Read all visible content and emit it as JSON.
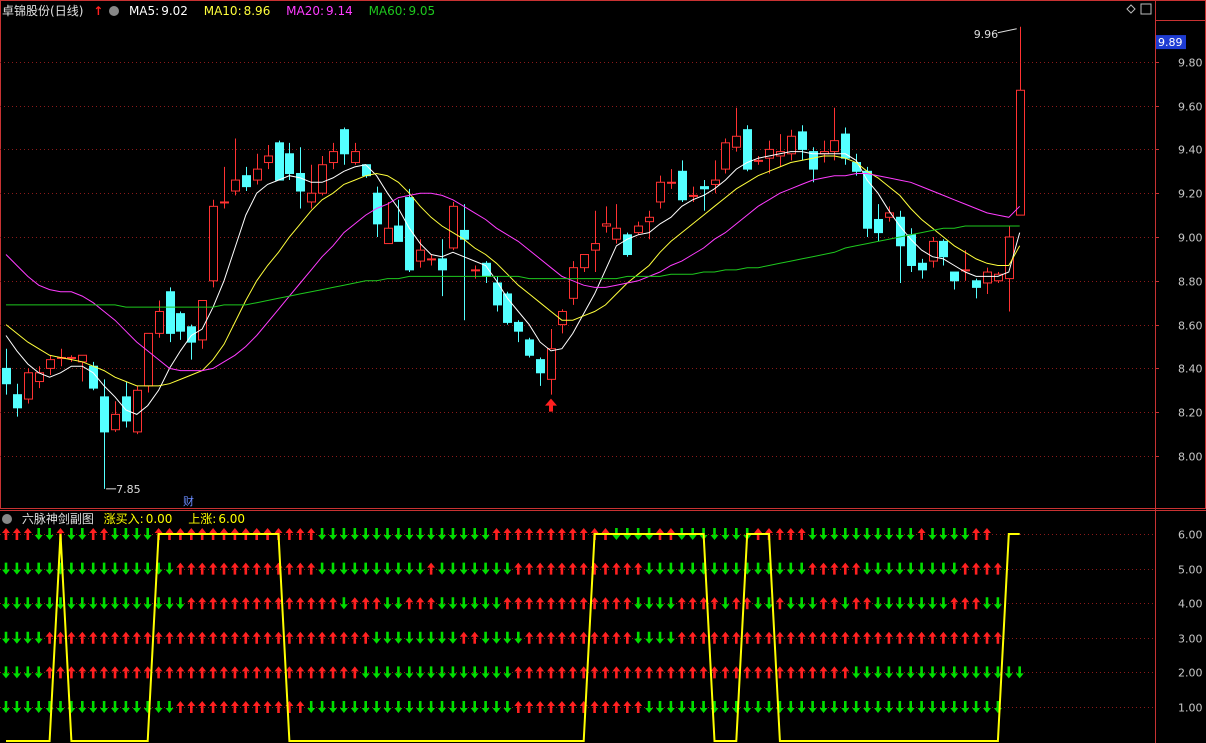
{
  "main_header": {
    "stock_name": "卓锦股份",
    "period": "(日线)",
    "ma5_label": "MA5:",
    "ma5_value": "9.02",
    "ma10_label": "MA10:",
    "ma10_value": "8.96",
    "ma20_label": "MA20:",
    "ma20_value": "9.14",
    "ma60_label": "MA60:",
    "ma60_value": "9.05"
  },
  "sub_header": {
    "indicator_name": "六脉神剑副图",
    "buy_label": "涨买入:",
    "buy_value": "0.00",
    "up_label": "上涨:",
    "up_value": "6.00"
  },
  "annotations": {
    "high_label": "9.96",
    "low_label": "7.85",
    "current_price": "9.89",
    "finance_marker": "财"
  },
  "colors": {
    "up": "#ff3232",
    "down": "#54ffff",
    "ma5": "#ffffff",
    "ma10": "#ffff3c",
    "ma20": "#ff3cff",
    "ma60": "#1ec81e",
    "grid": "#8a1a1a",
    "axis_text": "#c8c8c8",
    "signal_line": "#ffff00",
    "arrow_up": "#ff2020",
    "arrow_down": "#00dd00"
  },
  "chart_data": [
    {
      "type": "candlestick",
      "title": "卓锦股份 (日线)",
      "y_ticks": [
        "9.80",
        "9.60",
        "9.40",
        "9.20",
        "9.00",
        "8.80",
        "8.60",
        "8.40",
        "8.20",
        "8.00"
      ],
      "ylim": [
        7.8,
        10.05
      ],
      "grid": true,
      "candles": [
        [
          8.4,
          8.33,
          8.49,
          8.28
        ],
        [
          8.28,
          8.22,
          8.33,
          8.18
        ],
        [
          8.26,
          8.38,
          8.4,
          8.24
        ],
        [
          8.34,
          8.38,
          8.41,
          8.31
        ],
        [
          8.4,
          8.44,
          8.46,
          8.37
        ],
        [
          8.45,
          8.45,
          8.49,
          8.41
        ],
        [
          8.45,
          8.45,
          8.46,
          8.43
        ],
        [
          8.43,
          8.46,
          8.46,
          8.34
        ],
        [
          8.41,
          8.31,
          8.43,
          8.3
        ],
        [
          8.27,
          8.11,
          8.35,
          7.85
        ],
        [
          8.12,
          8.19,
          8.25,
          8.11
        ],
        [
          8.27,
          8.16,
          8.34,
          8.13
        ],
        [
          8.11,
          8.3,
          8.32,
          8.1
        ],
        [
          8.32,
          8.56,
          8.56,
          8.29
        ],
        [
          8.56,
          8.66,
          8.71,
          8.54
        ],
        [
          8.75,
          8.56,
          8.77,
          8.52
        ],
        [
          8.65,
          8.57,
          8.66,
          8.53
        ],
        [
          8.59,
          8.52,
          8.6,
          8.44
        ],
        [
          8.53,
          8.71,
          8.71,
          8.49
        ],
        [
          8.8,
          9.14,
          9.17,
          8.77
        ],
        [
          9.16,
          9.16,
          9.32,
          9.13
        ],
        [
          9.21,
          9.26,
          9.45,
          9.19
        ],
        [
          9.28,
          9.23,
          9.32,
          9.21
        ],
        [
          9.26,
          9.31,
          9.38,
          9.24
        ],
        [
          9.34,
          9.37,
          9.42,
          9.31
        ],
        [
          9.43,
          9.26,
          9.44,
          9.26
        ],
        [
          9.38,
          9.29,
          9.43,
          9.26
        ],
        [
          9.29,
          9.21,
          9.41,
          9.13
        ],
        [
          9.16,
          9.2,
          9.33,
          9.13
        ],
        [
          9.2,
          9.33,
          9.37,
          9.19
        ],
        [
          9.34,
          9.39,
          9.43,
          9.31
        ],
        [
          9.49,
          9.38,
          9.5,
          9.33
        ],
        [
          9.34,
          9.39,
          9.43,
          9.33
        ],
        [
          9.33,
          9.28,
          9.33,
          9.27
        ],
        [
          9.2,
          9.06,
          9.23,
          9.0
        ],
        [
          8.97,
          9.04,
          9.16,
          8.97
        ],
        [
          9.05,
          8.98,
          9.17,
          8.98
        ],
        [
          9.18,
          8.85,
          9.22,
          8.84
        ],
        [
          8.89,
          8.94,
          8.99,
          8.86
        ],
        [
          8.9,
          8.9,
          8.92,
          8.87
        ],
        [
          8.9,
          8.85,
          8.99,
          8.73
        ],
        [
          8.95,
          9.14,
          9.16,
          8.94
        ],
        [
          9.03,
          8.99,
          9.15,
          8.62
        ],
        [
          8.85,
          8.85,
          8.87,
          8.81
        ],
        [
          8.88,
          8.82,
          8.89,
          8.79
        ],
        [
          8.79,
          8.69,
          8.82,
          8.66
        ],
        [
          8.74,
          8.61,
          8.75,
          8.6
        ],
        [
          8.61,
          8.57,
          8.62,
          8.52
        ],
        [
          8.53,
          8.46,
          8.54,
          8.45
        ],
        [
          8.44,
          8.38,
          8.45,
          8.32
        ],
        [
          8.35,
          8.49,
          8.58,
          8.28
        ],
        [
          8.6,
          8.66,
          8.67,
          8.56
        ],
        [
          8.72,
          8.86,
          8.89,
          8.69
        ],
        [
          8.86,
          8.92,
          8.92,
          8.84
        ],
        [
          8.94,
          8.97,
          9.12,
          8.84
        ],
        [
          9.05,
          9.06,
          9.14,
          9.02
        ],
        [
          8.99,
          9.04,
          9.15,
          8.97
        ],
        [
          9.01,
          8.92,
          9.02,
          8.91
        ],
        [
          9.02,
          9.05,
          9.07,
          9.01
        ],
        [
          9.07,
          9.09,
          9.12,
          8.99
        ],
        [
          9.16,
          9.25,
          9.28,
          9.13
        ],
        [
          9.25,
          9.25,
          9.31,
          9.22
        ],
        [
          9.3,
          9.17,
          9.35,
          9.16
        ],
        [
          9.19,
          9.19,
          9.23,
          9.16
        ],
        [
          9.23,
          9.22,
          9.26,
          9.12
        ],
        [
          9.24,
          9.26,
          9.35,
          9.2
        ],
        [
          9.31,
          9.43,
          9.45,
          9.29
        ],
        [
          9.41,
          9.46,
          9.59,
          9.39
        ],
        [
          9.49,
          9.31,
          9.51,
          9.3
        ],
        [
          9.35,
          9.35,
          9.37,
          9.33
        ],
        [
          9.36,
          9.4,
          9.44,
          9.29
        ],
        [
          9.37,
          9.39,
          9.47,
          9.32
        ],
        [
          9.38,
          9.46,
          9.49,
          9.35
        ],
        [
          9.48,
          9.4,
          9.51,
          9.35
        ],
        [
          9.39,
          9.31,
          9.41,
          9.25
        ],
        [
          9.38,
          9.39,
          9.44,
          9.34
        ],
        [
          9.39,
          9.44,
          9.59,
          9.35
        ],
        [
          9.47,
          9.36,
          9.5,
          9.33
        ],
        [
          9.34,
          9.3,
          9.38,
          9.28
        ],
        [
          9.3,
          9.04,
          9.32,
          9.0
        ],
        [
          9.08,
          9.02,
          9.15,
          8.98
        ],
        [
          9.09,
          9.11,
          9.14,
          9.07
        ],
        [
          9.09,
          8.96,
          9.12,
          8.79
        ],
        [
          9.01,
          8.87,
          9.04,
          8.84
        ],
        [
          8.88,
          8.85,
          8.9,
          8.81
        ],
        [
          8.89,
          8.98,
          9.0,
          8.86
        ],
        [
          8.98,
          8.91,
          8.99,
          8.87
        ],
        [
          8.84,
          8.8,
          8.84,
          8.76
        ],
        [
          8.85,
          8.85,
          8.94,
          8.8
        ],
        [
          8.8,
          8.77,
          8.81,
          8.72
        ],
        [
          8.79,
          8.84,
          8.86,
          8.74
        ],
        [
          8.8,
          8.83,
          8.84,
          8.79
        ],
        [
          8.81,
          9.0,
          9.05,
          8.66
        ],
        [
          9.1,
          9.67,
          9.96,
          9.1
        ]
      ],
      "ma5": [
        8.55,
        8.48,
        8.42,
        8.38,
        8.36,
        8.38,
        8.41,
        8.41,
        8.38,
        8.32,
        8.27,
        8.21,
        8.19,
        8.23,
        8.3,
        8.4,
        8.48,
        8.55,
        8.58,
        8.68,
        8.8,
        8.95,
        9.1,
        9.2,
        9.24,
        9.26,
        9.28,
        9.27,
        9.25,
        9.25,
        9.27,
        9.3,
        9.32,
        9.33,
        9.28,
        9.2,
        9.13,
        9.04,
        8.97,
        8.92,
        8.91,
        8.93,
        8.91,
        8.89,
        8.87,
        8.8,
        8.72,
        8.66,
        8.6,
        8.52,
        8.48,
        8.49,
        8.56,
        8.65,
        8.74,
        8.85,
        8.96,
        8.99,
        9.01,
        9.02,
        9.06,
        9.09,
        9.14,
        9.17,
        9.19,
        9.22,
        9.26,
        9.31,
        9.34,
        9.36,
        9.37,
        9.38,
        9.39,
        9.39,
        9.38,
        9.38,
        9.38,
        9.38,
        9.35,
        9.26,
        9.2,
        9.12,
        9.05,
        8.99,
        8.94,
        8.91,
        8.9,
        8.87,
        8.84,
        8.82,
        8.82,
        8.82,
        8.84,
        9.02
      ],
      "ma10": [
        8.6,
        8.56,
        8.52,
        8.49,
        8.46,
        8.45,
        8.44,
        8.43,
        8.41,
        8.39,
        8.36,
        8.34,
        8.32,
        8.32,
        8.32,
        8.33,
        8.35,
        8.37,
        8.39,
        8.44,
        8.51,
        8.61,
        8.71,
        8.8,
        8.87,
        8.93,
        9.0,
        9.06,
        9.12,
        9.17,
        9.2,
        9.24,
        9.26,
        9.28,
        9.29,
        9.28,
        9.25,
        9.2,
        9.14,
        9.09,
        9.05,
        9.02,
        8.99,
        8.95,
        8.92,
        8.88,
        8.83,
        8.78,
        8.74,
        8.7,
        8.66,
        8.62,
        8.62,
        8.64,
        8.66,
        8.69,
        8.74,
        8.79,
        8.83,
        8.87,
        8.93,
        8.98,
        9.02,
        9.06,
        9.1,
        9.14,
        9.18,
        9.22,
        9.25,
        9.28,
        9.3,
        9.32,
        9.34,
        9.35,
        9.36,
        9.37,
        9.37,
        9.36,
        9.34,
        9.3,
        9.27,
        9.23,
        9.19,
        9.13,
        9.08,
        9.04,
        9.0,
        8.96,
        8.93,
        8.9,
        8.88,
        8.87,
        8.87,
        8.96
      ],
      "ma20": [
        8.92,
        8.87,
        8.82,
        8.78,
        8.76,
        8.75,
        8.75,
        8.73,
        8.7,
        8.66,
        8.62,
        8.57,
        8.52,
        8.48,
        8.44,
        8.4,
        8.39,
        8.39,
        8.39,
        8.4,
        8.43,
        8.46,
        8.5,
        8.55,
        8.61,
        8.67,
        8.73,
        8.79,
        8.85,
        8.91,
        8.96,
        9.02,
        9.06,
        9.1,
        9.13,
        9.15,
        9.18,
        9.19,
        9.2,
        9.2,
        9.19,
        9.17,
        9.14,
        9.11,
        9.08,
        9.04,
        9.01,
        8.98,
        8.94,
        8.9,
        8.86,
        8.82,
        8.8,
        8.78,
        8.77,
        8.77,
        8.78,
        8.79,
        8.8,
        8.82,
        8.84,
        8.87,
        8.89,
        8.92,
        8.95,
        8.99,
        9.02,
        9.06,
        9.1,
        9.14,
        9.17,
        9.2,
        9.22,
        9.24,
        9.26,
        9.27,
        9.28,
        9.28,
        9.29,
        9.29,
        9.28,
        9.27,
        9.26,
        9.25,
        9.23,
        9.21,
        9.19,
        9.17,
        9.15,
        9.13,
        9.11,
        9.1,
        9.09,
        9.14
      ],
      "ma60": [
        8.69,
        8.69,
        8.69,
        8.69,
        8.69,
        8.69,
        8.69,
        8.69,
        8.69,
        8.69,
        8.69,
        8.68,
        8.68,
        8.68,
        8.68,
        8.68,
        8.68,
        8.68,
        8.68,
        8.68,
        8.69,
        8.69,
        8.69,
        8.7,
        8.71,
        8.72,
        8.73,
        8.74,
        8.75,
        8.76,
        8.77,
        8.78,
        8.79,
        8.8,
        8.8,
        8.81,
        8.81,
        8.82,
        8.82,
        8.82,
        8.82,
        8.82,
        8.82,
        8.82,
        8.82,
        8.82,
        8.82,
        8.82,
        8.81,
        8.81,
        8.81,
        8.81,
        8.81,
        8.81,
        8.81,
        8.81,
        8.81,
        8.82,
        8.82,
        8.82,
        8.82,
        8.83,
        8.83,
        8.83,
        8.84,
        8.84,
        8.85,
        8.85,
        8.86,
        8.86,
        8.87,
        8.88,
        8.89,
        8.9,
        8.91,
        8.92,
        8.93,
        8.95,
        8.96,
        8.97,
        8.98,
        8.99,
        9.0,
        9.01,
        9.02,
        9.03,
        9.04,
        9.04,
        9.05,
        9.05,
        9.05,
        9.05,
        9.05,
        9.05
      ]
    },
    {
      "type": "signal",
      "title": "六脉神剑副图",
      "y_ticks": [
        "6.00",
        "5.00",
        "4.00",
        "3.00",
        "2.00",
        "1.00"
      ],
      "rows": [
        "uuuddudduudddduuuuuuuuuuuuuuudddddddddddddddduuuuuuuuuuudddduuddddddduuuuuddddddddddudddduu",
        "dddddddddddddddduuuuuuuuuuuuudddddddddduddddddduuuuuuuuuuuuddddddddddddddduuuuuddddddddduuuu",
        "ddddddddddddddddduuuuuuuuuuuuuuduuudduuudddddduuuuuuuuuuuudddduuuuduudduddduuduuddddddduuudd",
        "dddduuuuuuuuuuuuuuuuuuuuuuuuuuuuuudddddddduudddduuuuuuuuuudddduuuuuuuuuuuuuuuuuuuuuuuuuuuuuu",
        "dddduuuuuuuuuuuuuuuuuuuuuuuuuuuuudddddddddddddduuuuuuuuuuuuuuuuuuuuuuuuuuuuuuudddddddddddddddd",
        "dddddddddddddddduuuuuuuuuuuuddddddddddddddddddduuuuuuuuuuuuddddddddddddddddddddddddddddddddd"
      ],
      "signal_line": [
        0,
        0,
        0,
        0,
        0,
        6,
        0,
        0,
        0,
        0,
        0,
        0,
        0,
        0,
        6,
        6,
        6,
        6,
        6,
        6,
        6,
        6,
        6,
        6,
        6,
        6,
        0,
        0,
        0,
        0,
        0,
        0,
        0,
        0,
        0,
        0,
        0,
        0,
        0,
        0,
        0,
        0,
        0,
        0,
        0,
        0,
        0,
        0,
        0,
        0,
        0,
        0,
        0,
        0,
        6,
        6,
        6,
        6,
        6,
        6,
        6,
        6,
        6,
        6,
        6,
        0,
        0,
        0,
        6,
        6,
        6,
        0,
        0,
        0,
        0,
        0,
        0,
        0,
        0,
        0,
        0,
        0,
        0,
        0,
        0,
        0,
        0,
        0,
        0,
        0,
        0,
        0,
        6,
        6
      ]
    }
  ]
}
